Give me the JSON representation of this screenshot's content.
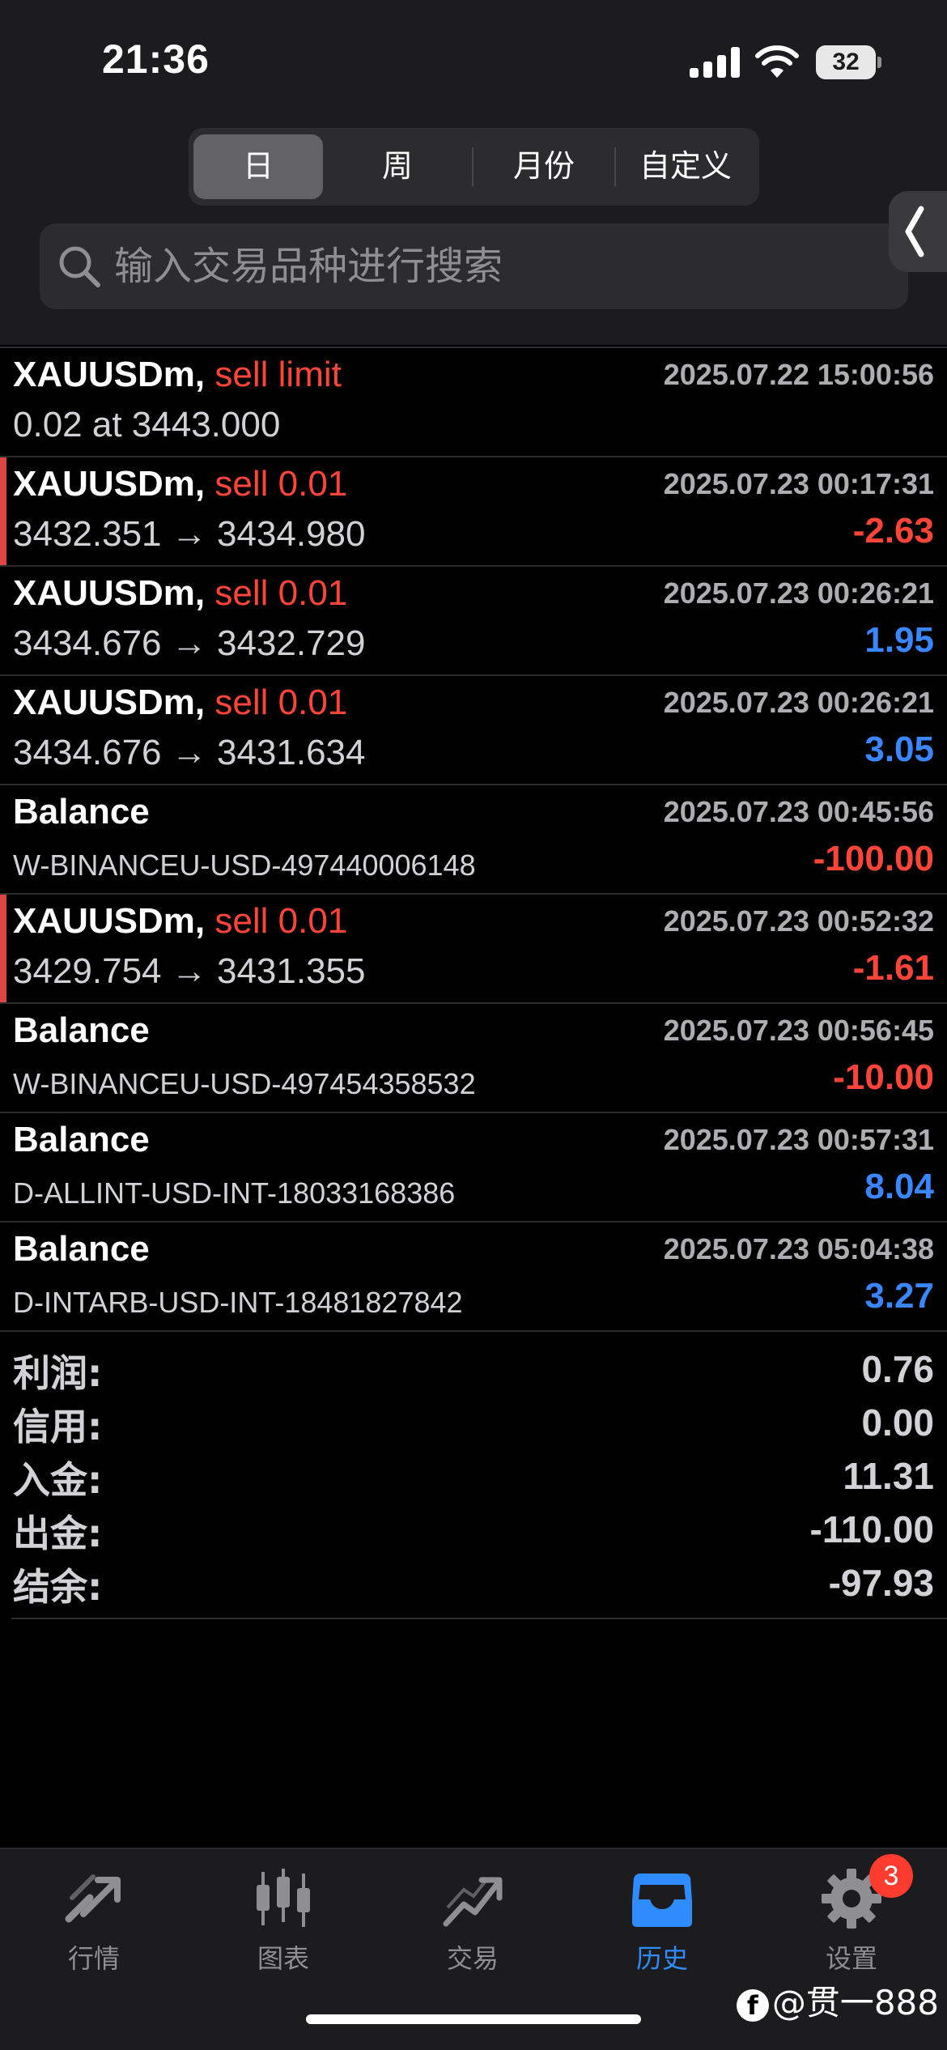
{
  "status_bar": {
    "time": "21:36",
    "battery": "32"
  },
  "segments": [
    {
      "label": "日",
      "active": true
    },
    {
      "label": "周",
      "active": false
    },
    {
      "label": "月份",
      "active": false
    },
    {
      "label": "自定义",
      "active": false
    }
  ],
  "search": {
    "placeholder": "输入交易品种进行搜索"
  },
  "rows": [
    {
      "symbol": "XAUUSDm,",
      "action": "sell limit",
      "date": "2025.07.22 15:00:56",
      "detail": "0.02 at 3443.000",
      "amount": ""
    },
    {
      "symbol": "XAUUSDm,",
      "action": "sell 0.01",
      "date": "2025.07.23 00:17:31",
      "detail": "3432.351 → 3434.980",
      "amount": "-2.63"
    },
    {
      "symbol": "XAUUSDm,",
      "action": "sell 0.01",
      "date": "2025.07.23 00:26:21",
      "detail": "3434.676 → 3432.729",
      "amount": "1.95"
    },
    {
      "symbol": "XAUUSDm,",
      "action": "sell 0.01",
      "date": "2025.07.23 00:26:21",
      "detail": "3434.676 → 3431.634",
      "amount": "3.05"
    },
    {
      "symbol": "Balance",
      "action": "",
      "date": "2025.07.23 00:45:56",
      "detail": "W-BINANCEU-USD-497440006148",
      "amount": "-100.00"
    },
    {
      "symbol": "XAUUSDm,",
      "action": "sell 0.01",
      "date": "2025.07.23 00:52:32",
      "detail": "3429.754 → 3431.355",
      "amount": "-1.61"
    },
    {
      "symbol": "Balance",
      "action": "",
      "date": "2025.07.23 00:56:45",
      "detail": "W-BINANCEU-USD-497454358532",
      "amount": "-10.00"
    },
    {
      "symbol": "Balance",
      "action": "",
      "date": "2025.07.23 00:57:31",
      "detail": "D-ALLINT-USD-INT-18033168386",
      "amount": "8.04"
    },
    {
      "symbol": "Balance",
      "action": "",
      "date": "2025.07.23 05:04:38",
      "detail": "D-INTARB-USD-INT-18481827842",
      "amount": "3.27"
    }
  ],
  "summary": [
    {
      "label": "利润:",
      "value": "0.76"
    },
    {
      "label": "信用:",
      "value": "0.00"
    },
    {
      "label": "入金:",
      "value": "11.31"
    },
    {
      "label": "出金:",
      "value": "-110.00"
    },
    {
      "label": "结余:",
      "value": "-97.93"
    }
  ],
  "tabs": [
    {
      "label": "行情",
      "icon": "quotes-icon",
      "active": false
    },
    {
      "label": "图表",
      "icon": "candlestick-chart-icon",
      "active": false
    },
    {
      "label": "交易",
      "icon": "trade-icon",
      "active": false
    },
    {
      "label": "历史",
      "icon": "history-inbox-icon",
      "active": true
    },
    {
      "label": "设置",
      "icon": "gear-icon",
      "active": false
    }
  ],
  "settings_badge": "3",
  "watermark": "@贯一888",
  "colors": {
    "negative": "#ff453a",
    "positive": "#3a86ff",
    "accent": "#2f8cff",
    "active_segment": "#636366"
  }
}
